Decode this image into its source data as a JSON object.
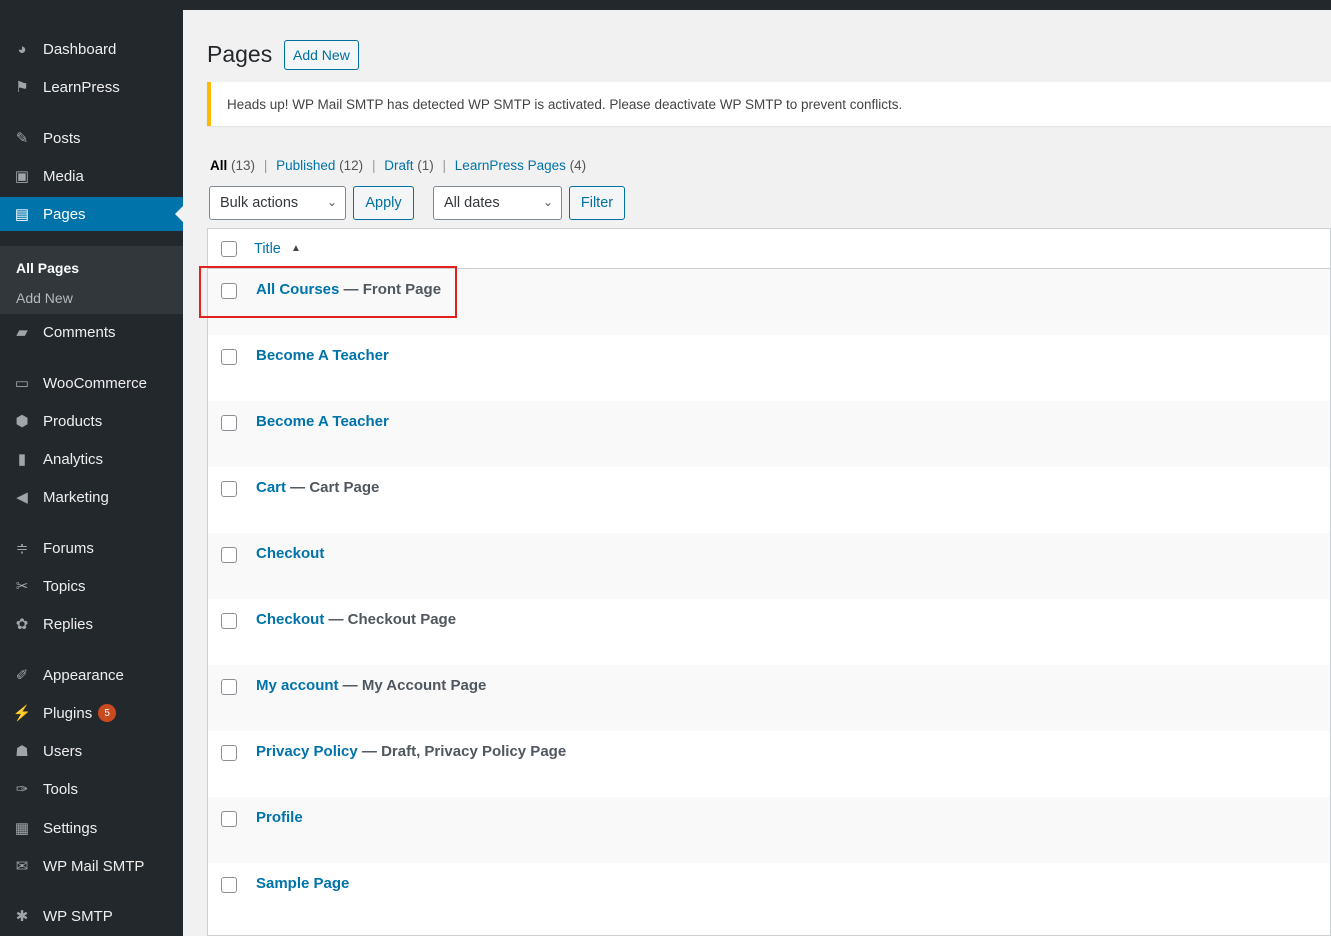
{
  "sidebar": {
    "items": [
      {
        "label": "Dashboard",
        "icon": "dashboard-icon",
        "glyph": "◕"
      },
      {
        "label": "LearnPress",
        "icon": "learnpress-icon",
        "glyph": "⚑"
      },
      {
        "label": "Posts",
        "icon": "pin-icon",
        "glyph": "✎"
      },
      {
        "label": "Media",
        "icon": "media-icon",
        "glyph": "▣"
      },
      {
        "label": "Pages",
        "icon": "pages-icon",
        "glyph": "▤"
      },
      {
        "label": "Comments",
        "icon": "comments-icon",
        "glyph": "▰"
      },
      {
        "label": "WooCommerce",
        "icon": "woocommerce-icon",
        "glyph": "▭"
      },
      {
        "label": "Products",
        "icon": "products-icon",
        "glyph": "⬢"
      },
      {
        "label": "Analytics",
        "icon": "analytics-icon",
        "glyph": "▮"
      },
      {
        "label": "Marketing",
        "icon": "megaphone-icon",
        "glyph": "◀"
      },
      {
        "label": "Forums",
        "icon": "forums-icon",
        "glyph": "≑"
      },
      {
        "label": "Topics",
        "icon": "topics-icon",
        "glyph": "✂"
      },
      {
        "label": "Replies",
        "icon": "replies-icon",
        "glyph": "✿"
      },
      {
        "label": "Appearance",
        "icon": "appearance-icon",
        "glyph": "✐"
      },
      {
        "label": "Plugins",
        "icon": "plugins-icon",
        "glyph": "⚡",
        "badge": "5"
      },
      {
        "label": "Users",
        "icon": "users-icon",
        "glyph": "☗"
      },
      {
        "label": "Tools",
        "icon": "tools-icon",
        "glyph": "✑"
      },
      {
        "label": "Settings",
        "icon": "settings-icon",
        "glyph": "▦"
      },
      {
        "label": "WP Mail SMTP",
        "icon": "mail-icon",
        "glyph": "✉"
      },
      {
        "label": "WP SMTP",
        "icon": "gear-icon",
        "glyph": "✱"
      }
    ],
    "submenu": [
      "All Pages",
      "Add New"
    ]
  },
  "header": {
    "title": "Pages",
    "add_new": "Add New"
  },
  "notice": "Heads up! WP Mail SMTP has detected WP SMTP is activated. Please deactivate WP SMTP to prevent conflicts.",
  "filters": {
    "all_label": "All",
    "all_count": "(13)",
    "published_label": "Published",
    "published_count": "(12)",
    "draft_label": "Draft",
    "draft_count": "(1)",
    "learnpress_label": "LearnPress Pages",
    "learnpress_count": "(4)",
    "bulk_actions": "Bulk actions",
    "apply": "Apply",
    "dates": "All dates",
    "filter": "Filter"
  },
  "table": {
    "column_title": "Title",
    "rows": [
      {
        "title": "All Courses",
        "state": " — Front Page"
      },
      {
        "title": "Become A Teacher",
        "state": ""
      },
      {
        "title": "Become A Teacher",
        "state": ""
      },
      {
        "title": "Cart",
        "state": " — Cart Page"
      },
      {
        "title": "Checkout",
        "state": ""
      },
      {
        "title": "Checkout",
        "state": " — Checkout Page"
      },
      {
        "title": "My account",
        "state": " — My Account Page"
      },
      {
        "title": "Privacy Policy",
        "state": " — Draft, Privacy Policy Page"
      },
      {
        "title": "Profile",
        "state": ""
      },
      {
        "title": "Sample Page",
        "state": ""
      }
    ]
  },
  "colors": {
    "accent": "#0073aa",
    "sidebar": "#23282d",
    "highlight": "#e2201e",
    "notice": "#ffb900"
  }
}
